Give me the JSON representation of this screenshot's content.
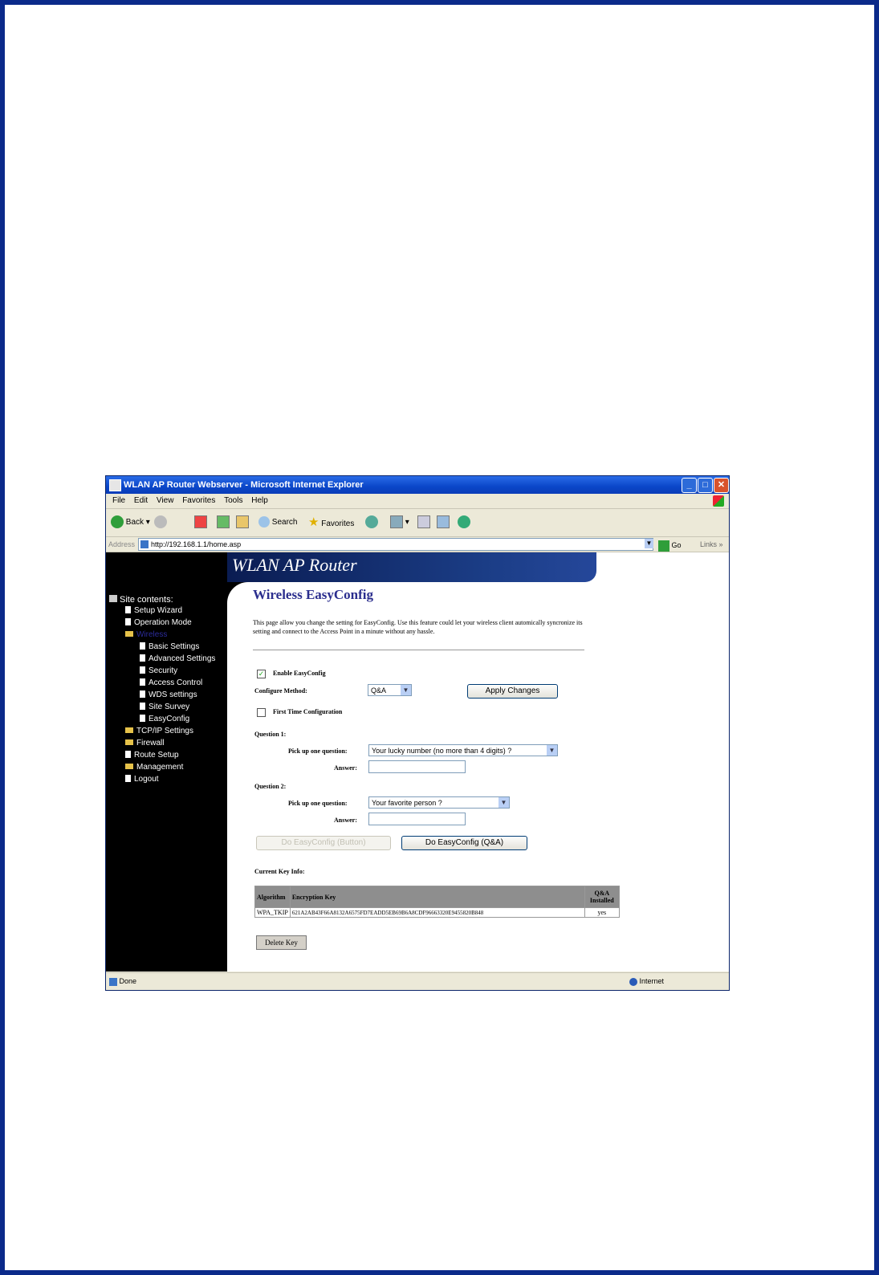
{
  "window": {
    "title": "WLAN AP Router Webserver - Microsoft Internet Explorer"
  },
  "menu": [
    "File",
    "Edit",
    "View",
    "Favorites",
    "Tools",
    "Help"
  ],
  "toolbar": {
    "back": "Back",
    "search": "Search",
    "favorites": "Favorites"
  },
  "address": {
    "label": "Address",
    "url": "http://192.168.1.1/home.asp",
    "go": "Go",
    "links": "Links"
  },
  "brand": "WLAN AP Router",
  "sidebar": {
    "root": "Site contents:",
    "items": [
      {
        "label": "Setup Wizard"
      },
      {
        "label": "Operation Mode"
      },
      {
        "label": "Wireless"
      },
      {
        "label": "Basic Settings"
      },
      {
        "label": "Advanced Settings"
      },
      {
        "label": "Security"
      },
      {
        "label": "Access Control"
      },
      {
        "label": "WDS settings"
      },
      {
        "label": "Site Survey"
      },
      {
        "label": "EasyConfig"
      },
      {
        "label": "TCP/IP Settings"
      },
      {
        "label": "Firewall"
      },
      {
        "label": "Route Setup"
      },
      {
        "label": "Management"
      },
      {
        "label": "Logout"
      }
    ]
  },
  "page": {
    "title": "Wireless EasyConfig",
    "description": "This page allow you change the setting for EasyConfig. Use this feature could let your wireless client automically syncronize its setting and connect to the Access Point in a minute without any hassle.",
    "enable_label": "Enable EasyConfig",
    "enable_checked": true,
    "method_label": "Configure Method:",
    "method_value": "Q&A",
    "apply_button": "Apply Changes",
    "first_time_label": "First Time Configuration",
    "first_time_checked": false,
    "q1_heading": "Question 1:",
    "q1_pick_label": "Pick up one question:",
    "q1_question": "Your lucky number (no more than 4 digits) ?",
    "q1_answer_label": "Answer:",
    "q1_answer": "",
    "q2_heading": "Question 2:",
    "q2_pick_label": "Pick up one question:",
    "q2_question": "Your favorite person ?",
    "q2_answer_label": "Answer:",
    "q2_answer": "",
    "do_button": "Do EasyConfig (Button)",
    "do_qa": "Do EasyConfig (Q&A)",
    "key_info_heading": "Current Key Info:",
    "key_table": {
      "headers": [
        "Algorithm",
        "Encryption Key",
        "Q&A Installed"
      ],
      "rows": [
        [
          "WPA_TKIP",
          "621A2AB43F66A8132A6575FD7EADD5EB69B6A8CDF96663320E9455820B848",
          "yes"
        ]
      ]
    },
    "delete_button": "Delete Key"
  },
  "status": {
    "left": "Done",
    "right": "Internet"
  }
}
